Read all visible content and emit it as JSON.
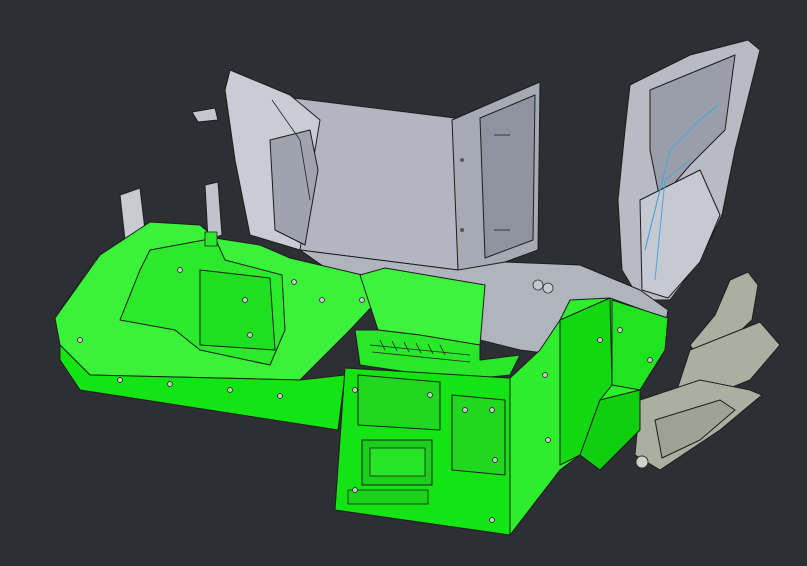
{
  "viewport": {
    "background_color": "#2e2e35"
  },
  "model": {
    "highlight_color": "#14f014",
    "part_color": "#a9adb8",
    "bracket_color": "#aab0a0"
  }
}
